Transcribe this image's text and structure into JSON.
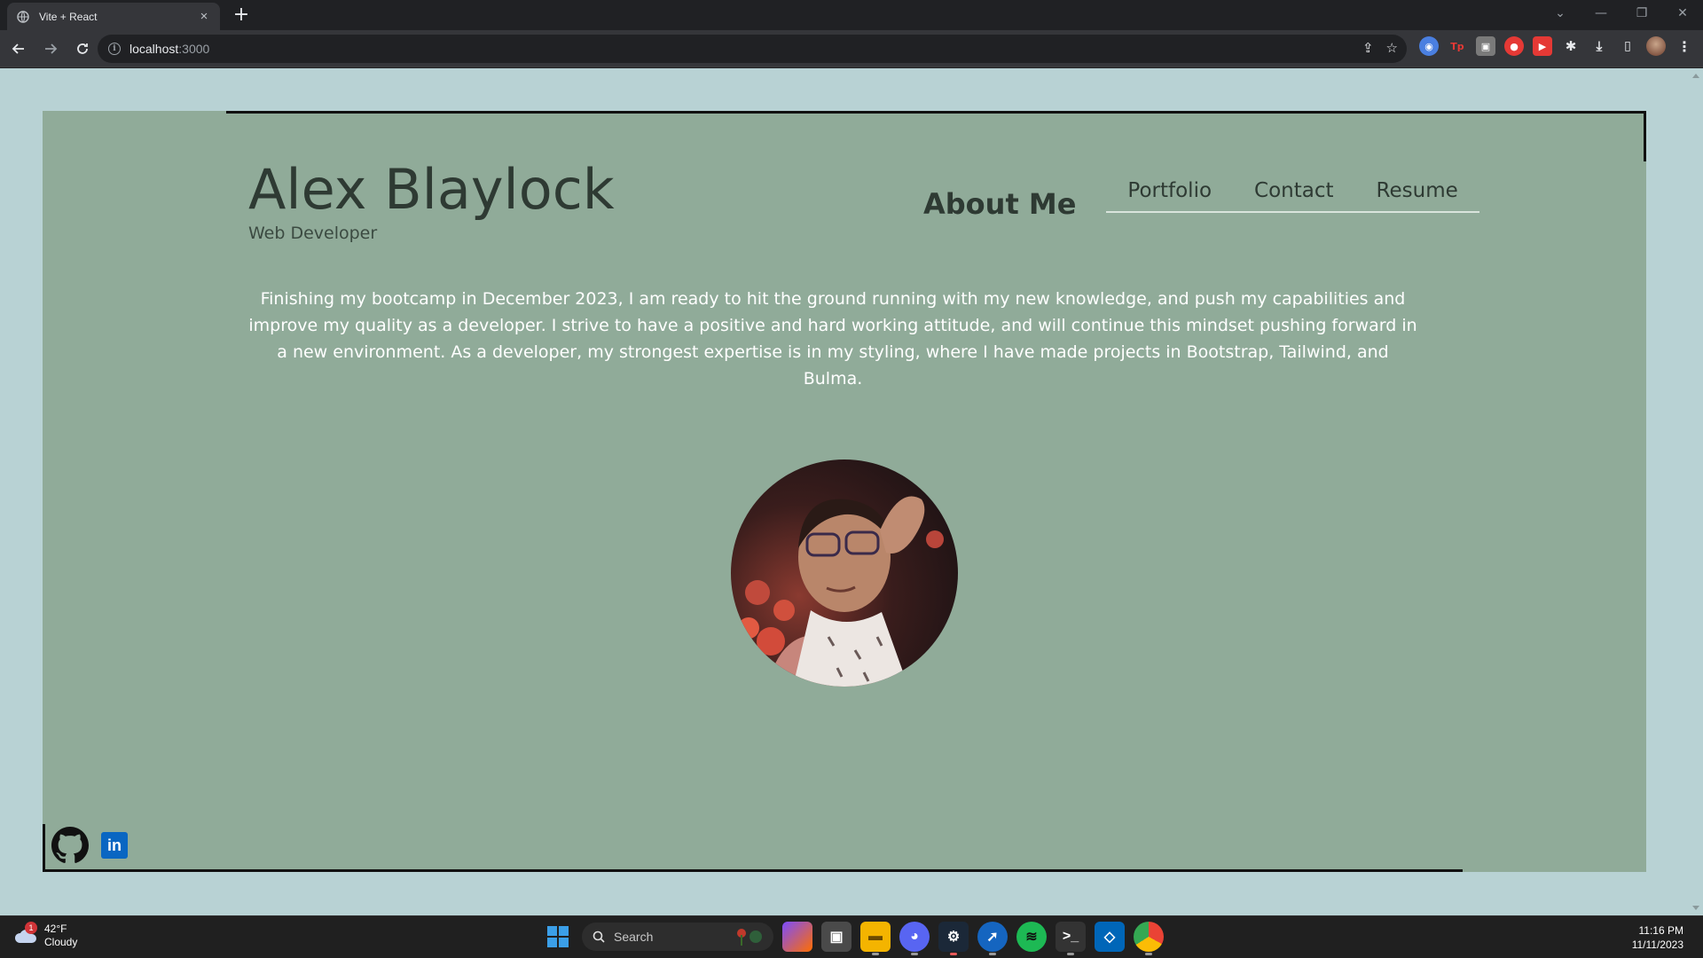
{
  "browser": {
    "tab_title": "Vite + React",
    "tab_close": "×",
    "new_tab": "+",
    "url_host": "localhost",
    "url_port": ":3000",
    "window_controls": [
      "⌄",
      "—",
      "❐",
      "✕"
    ]
  },
  "page": {
    "name": "Alex Blaylock",
    "subtitle": "Web Developer",
    "nav": {
      "active": "About Me",
      "links": [
        "Portfolio",
        "Contact",
        "Resume"
      ]
    },
    "bio": "Finishing my bootcamp in December 2023, I am ready to hit the ground running with my new knowledge, and push my capabilities and improve my quality as a developer. I strive to have a positive and hard working attitude, and will continue this mindset pushing forward in a new environment. As a developer, my strongest expertise is in my styling, where I have made projects in Bootstrap, Tailwind, and Bulma.",
    "social": {
      "github_icon": "github-icon",
      "linkedin_icon": "linkedin-icon",
      "linkedin_text": "in"
    },
    "colors": {
      "page_bg": "#b8d2d4",
      "card_bg": "#90ab99",
      "text_dark": "#2e3a33",
      "bio_text": "#ffffff"
    }
  },
  "taskbar": {
    "weather_temp": "42°F",
    "weather_desc": "Cloudy",
    "weather_badge": "1",
    "search_placeholder": "Search",
    "time": "11:16 PM",
    "date": "11/11/2023"
  }
}
